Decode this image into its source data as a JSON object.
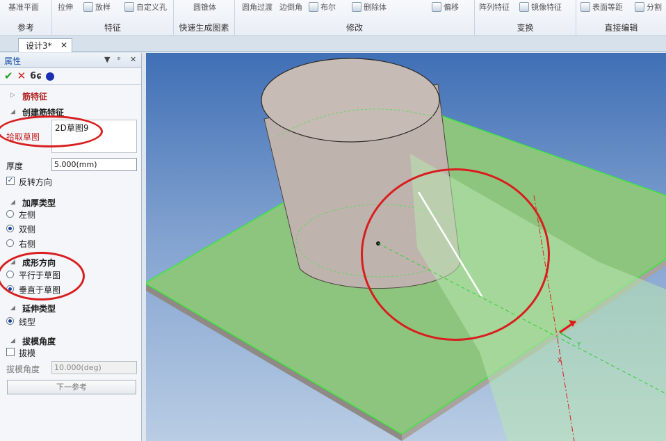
{
  "ribbon": {
    "groups": [
      {
        "label": "参考",
        "tools": [
          "基准平面"
        ]
      },
      {
        "label": "特征",
        "tools": [
          "拉伸",
          "放样",
          "自定义孔"
        ]
      },
      {
        "label": "快速生成图素",
        "tools": [
          "圆锥体"
        ]
      },
      {
        "label": "修改",
        "tools": [
          "圆角过渡",
          "边倒角",
          "布尔",
          "删除体",
          "偏移"
        ]
      },
      {
        "label": "变换",
        "tools": [
          "阵列特征",
          "镜像特征"
        ]
      },
      {
        "label": "直接编辑",
        "tools": [
          "表面等距",
          "分割"
        ]
      }
    ]
  },
  "tabs": {
    "active": "设计3*",
    "close": "✕"
  },
  "panel": {
    "title": "属性",
    "header_buttons": [
      "▼",
      "ᵖ",
      "✕"
    ],
    "feature_name": "筋特征",
    "create_section": "创建筋特征",
    "pick_sketch_label": "拾取草图",
    "sketch_value": "2D草图9",
    "thickness_label": "厚度",
    "thickness_value": "5.000(mm)",
    "reverse_label": "反转方向",
    "thicken_type_title": "加厚类型",
    "thicken_options": [
      "左侧",
      "双侧",
      "右侧"
    ],
    "form_direction_title": "成形方向",
    "form_options": [
      "平行于草图",
      "垂直于草图"
    ],
    "extend_type_title": "延伸类型",
    "extend_option": "线型",
    "draft_title": "拔模角度",
    "draft_checkbox": "拔模",
    "draft_angle_label": "拔模角度",
    "draft_angle_value": "10.000(deg)",
    "next_button": "下一参考"
  },
  "viewport": {
    "axis_labels": [
      "Y",
      "X"
    ],
    "colors": {
      "plate_top": "#8ec57e",
      "plate_edge": "#3de83d",
      "cylinder": "#bfb3ad",
      "annotation": "#d81e1e"
    }
  }
}
